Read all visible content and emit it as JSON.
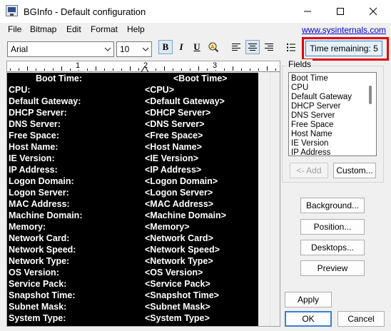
{
  "window": {
    "title": "BGInfo - Default configuration",
    "icons": [
      "app-icon",
      "minimize-icon",
      "maximize-icon",
      "close-icon"
    ]
  },
  "menu": {
    "items": [
      "File",
      "Bitmap",
      "Edit",
      "Format",
      "Help"
    ],
    "link": "www.sysinternals.com"
  },
  "toolbar": {
    "font": "Arial",
    "size": "10",
    "bold": "B",
    "italic": "I",
    "underline": "U",
    "time_remaining": "Time remaining: 5",
    "icons": [
      "bold-icon",
      "italic-icon",
      "underline-icon",
      "font-color-icon",
      "align-left-icon",
      "align-center-icon",
      "align-right-icon",
      "bullet-list-icon"
    ],
    "pressed": [
      "bold",
      "align-center"
    ]
  },
  "ruler": {
    "marks": [
      "1",
      "2",
      "3"
    ]
  },
  "editor": {
    "rows": [
      {
        "label": "Boot Time:",
        "value": "<Boot Time>"
      },
      {
        "label": "CPU:",
        "value": "<CPU>"
      },
      {
        "label": "Default Gateway:",
        "value": "<Default Gateway>"
      },
      {
        "label": "DHCP Server:",
        "value": "<DHCP Server>"
      },
      {
        "label": "DNS Server:",
        "value": "<DNS Server>"
      },
      {
        "label": "Free Space:",
        "value": "<Free Space>"
      },
      {
        "label": "Host Name:",
        "value": "<Host Name>"
      },
      {
        "label": "IE Version:",
        "value": "<IE Version>"
      },
      {
        "label": "IP Address:",
        "value": "<IP Address>"
      },
      {
        "label": "Logon Domain:",
        "value": "<Logon Domain>"
      },
      {
        "label": "Logon Server:",
        "value": "<Logon Server>"
      },
      {
        "label": "MAC Address:",
        "value": "<MAC Address>"
      },
      {
        "label": "Machine Domain:",
        "value": "<Machine Domain>"
      },
      {
        "label": "Memory:",
        "value": "<Memory>"
      },
      {
        "label": "Network Card:",
        "value": "<Network Card>"
      },
      {
        "label": "Network Speed:",
        "value": "<Network Speed>"
      },
      {
        "label": "Network Type:",
        "value": "<Network Type>"
      },
      {
        "label": "OS Version:",
        "value": "<OS Version>"
      },
      {
        "label": "Service Pack:",
        "value": "<Service Pack>"
      },
      {
        "label": "Snapshot Time:",
        "value": "<Snapshot Time>"
      },
      {
        "label": "Subnet Mask:",
        "value": "<Subnet Mask>"
      },
      {
        "label": "System Type:",
        "value": "<System Type>"
      }
    ]
  },
  "fields": {
    "title": "Fields",
    "items": [
      "Boot Time",
      "CPU",
      "Default Gateway",
      "DHCP Server",
      "DNS Server",
      "Free Space",
      "Host Name",
      "IE Version",
      "IP Address"
    ],
    "add": "<- Add",
    "custom": "Custom..."
  },
  "buttons": {
    "background": "Background...",
    "position": "Position...",
    "desktops": "Desktops...",
    "preview": "Preview",
    "apply": "Apply",
    "ok": "OK",
    "cancel": "Cancel"
  },
  "colors": {
    "highlight": "#e00000",
    "link": "#0000cc",
    "editor_bg": "#000000",
    "accent": "#3a7fd0"
  }
}
